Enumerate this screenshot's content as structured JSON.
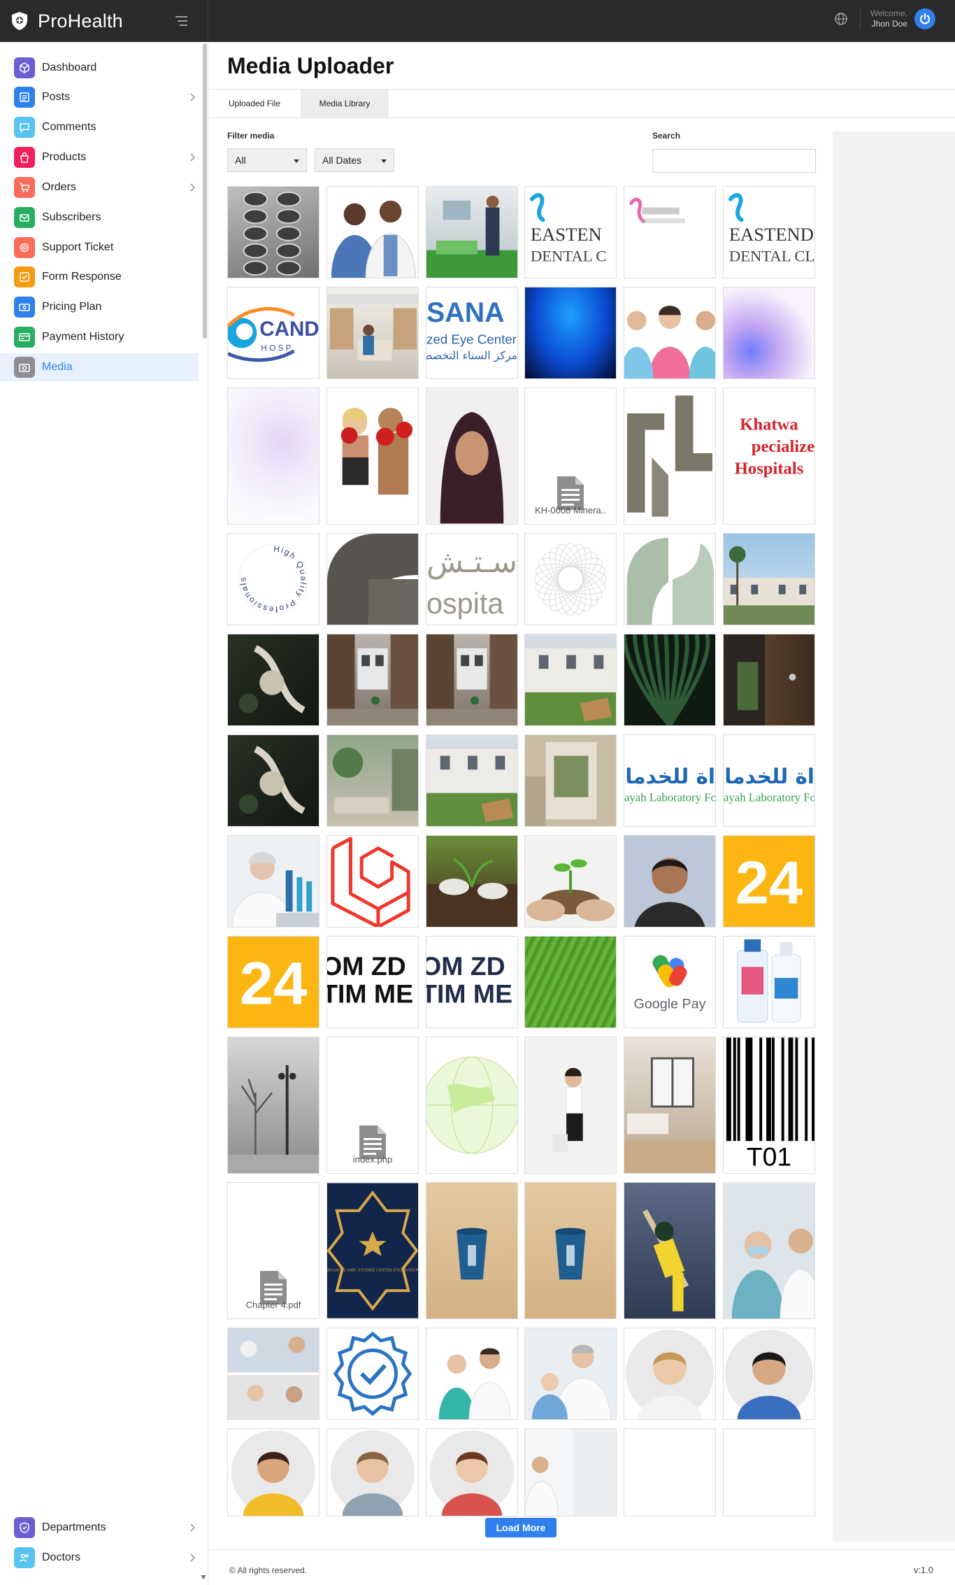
{
  "app": {
    "brand": "ProHealth"
  },
  "header": {
    "welcome_label": "Welcome,",
    "user_name": "Jhon Doe"
  },
  "sidebar": {
    "items": [
      {
        "label": "Dashboard",
        "icon": "cube-icon",
        "color": "#6c5dd3",
        "has_submenu": false
      },
      {
        "label": "Posts",
        "icon": "news-icon",
        "color": "#2f80ed",
        "has_submenu": true
      },
      {
        "label": "Comments",
        "icon": "comment-icon",
        "color": "#56c3f0",
        "has_submenu": false
      },
      {
        "label": "Products",
        "icon": "bag-icon",
        "color": "#f0205a",
        "has_submenu": true
      },
      {
        "label": "Orders",
        "icon": "cart-icon",
        "color": "#fb6b5b",
        "has_submenu": true
      },
      {
        "label": "Subscribers",
        "icon": "mail-icon",
        "color": "#27ae60",
        "has_submenu": false
      },
      {
        "label": "Support Ticket",
        "icon": "support-icon",
        "color": "#fb6b5b",
        "has_submenu": false
      },
      {
        "label": "Form Response",
        "icon": "form-icon",
        "color": "#f39c12",
        "has_submenu": false
      },
      {
        "label": "Pricing Plan",
        "icon": "money-icon",
        "color": "#2f80ed",
        "has_submenu": false
      },
      {
        "label": "Payment History",
        "icon": "receipt-icon",
        "color": "#27ae60",
        "has_submenu": false
      },
      {
        "label": "Media",
        "icon": "camera-icon",
        "color": "#8e8e93",
        "has_submenu": false,
        "active": true
      },
      {
        "label": "Departments",
        "icon": "shield-icon",
        "color": "#6c5dd3",
        "has_submenu": true
      },
      {
        "label": "Doctors",
        "icon": "people-icon",
        "color": "#56c3f0",
        "has_submenu": true
      }
    ]
  },
  "page": {
    "title": "Media Uploader",
    "tabs": [
      {
        "label": "Uploaded File"
      },
      {
        "label": "Media Library"
      }
    ],
    "filter_label": "Filter media",
    "filter_type": "All",
    "filter_date": "All Dates",
    "search_label": "Search",
    "search_value": ""
  },
  "media": {
    "items": [
      {
        "kind": "pills",
        "name": ""
      },
      {
        "kind": "doctors",
        "name": ""
      },
      {
        "kind": "hospital-room",
        "name": ""
      },
      {
        "kind": "logo-eastend",
        "name": "",
        "text1": "EASTEN",
        "text2": "DENTAL C"
      },
      {
        "kind": "logo-eastend-small",
        "name": ""
      },
      {
        "kind": "logo-eastend",
        "name": "",
        "text1": "EASTEND",
        "text2": "DENTAL CLIN"
      },
      {
        "kind": "logo-cand",
        "name": "",
        "text1": "CAND",
        "text2": "H O S P"
      },
      {
        "kind": "pharmacy",
        "name": ""
      },
      {
        "kind": "logo-sana",
        "name": "",
        "text1": "SANA",
        "text2": "zed Eye Center",
        "text3": "مركز السناء التخصص"
      },
      {
        "kind": "blue-gradient",
        "name": ""
      },
      {
        "kind": "nurses",
        "name": ""
      },
      {
        "kind": "pastel",
        "name": ""
      },
      {
        "kind": "pastel-light",
        "name": ""
      },
      {
        "kind": "boxers",
        "name": ""
      },
      {
        "kind": "portrait-hijab",
        "name": ""
      },
      {
        "kind": "document",
        "name": "KH-0008 Minera.."
      },
      {
        "kind": "khatwa-mark",
        "name": ""
      },
      {
        "kind": "khatwa-text",
        "name": "",
        "text1": "Khatwa",
        "text2": "pecialize",
        "text3": "Hospitals"
      },
      {
        "kind": "ring-text",
        "name": "",
        "text1": "High Quality Professionals"
      },
      {
        "kind": "shapes-dark",
        "name": ""
      },
      {
        "kind": "arabic-hospital",
        "name": "",
        "text1": "سـتـش",
        "text2": "ospita"
      },
      {
        "kind": "line-pattern",
        "name": ""
      },
      {
        "kind": "shapes-green",
        "name": ""
      },
      {
        "kind": "building",
        "name": ""
      },
      {
        "kind": "aerial-dark",
        "name": ""
      },
      {
        "kind": "corridor",
        "name": ""
      },
      {
        "kind": "corridor",
        "name": ""
      },
      {
        "kind": "courtyard",
        "name": ""
      },
      {
        "kind": "palm-leaf",
        "name": ""
      },
      {
        "kind": "door",
        "name": ""
      },
      {
        "kind": "aerial-dark",
        "name": ""
      },
      {
        "kind": "lounge",
        "name": ""
      },
      {
        "kind": "courtyard",
        "name": ""
      },
      {
        "kind": "beige-mockup",
        "name": ""
      },
      {
        "kind": "arabic-lab",
        "name": "",
        "text1": "اة للخدمات",
        "text2": "ayah Laboratory Fo"
      },
      {
        "kind": "arabic-lab",
        "name": "",
        "text1": "اة للخدمات",
        "text2": "ayah Laboratory Fo"
      },
      {
        "kind": "scientist",
        "name": ""
      },
      {
        "kind": "laravel",
        "name": ""
      },
      {
        "kind": "planting",
        "name": ""
      },
      {
        "kind": "seedling",
        "name": ""
      },
      {
        "kind": "man-portrait",
        "name": ""
      },
      {
        "kind": "num24",
        "name": "",
        "text1": "24"
      },
      {
        "kind": "num24",
        "name": "",
        "text1": "24"
      },
      {
        "kind": "omzd",
        "name": "",
        "text1": "OM ZD",
        "text2": "TIM ME"
      },
      {
        "kind": "omzd-navy",
        "name": "",
        "text1": "OM ZD",
        "text2": "TIM ME"
      },
      {
        "kind": "green-field",
        "name": ""
      },
      {
        "kind": "google-pay",
        "name": "",
        "text1": "Google Pay"
      },
      {
        "kind": "spray",
        "name": ""
      },
      {
        "kind": "foggy",
        "name": ""
      },
      {
        "kind": "document",
        "name": "index.php"
      },
      {
        "kind": "globe",
        "name": ""
      },
      {
        "kind": "woman-office",
        "name": ""
      },
      {
        "kind": "bedroom",
        "name": ""
      },
      {
        "kind": "barcode",
        "name": "",
        "text1": "T01"
      },
      {
        "kind": "document",
        "name": "Chapter 4.pdf"
      },
      {
        "kind": "qiyam",
        "name": "",
        "text1": "QIYAM ISLAMIC STUDIES CENTER FOUNDATION"
      },
      {
        "kind": "cup",
        "name": ""
      },
      {
        "kind": "cup",
        "name": ""
      },
      {
        "kind": "cricket",
        "name": ""
      },
      {
        "kind": "nurses-mask",
        "name": ""
      },
      {
        "kind": "care-collage",
        "name": ""
      },
      {
        "kind": "badge-check",
        "name": ""
      },
      {
        "kind": "medical-team",
        "name": ""
      },
      {
        "kind": "doctor-child",
        "name": ""
      },
      {
        "kind": "woman-round",
        "name": ""
      },
      {
        "kind": "man-round",
        "name": ""
      },
      {
        "kind": "woman-round-2",
        "name": ""
      },
      {
        "kind": "man-round-2",
        "name": ""
      },
      {
        "kind": "girl-round",
        "name": ""
      },
      {
        "kind": "doctor-window",
        "name": ""
      },
      {
        "kind": "blank",
        "name": ""
      },
      {
        "kind": "blank",
        "name": ""
      }
    ]
  },
  "actions": {
    "load_more": "Load More"
  },
  "footer": {
    "copyright": "© All rights reserved.",
    "version": "v:1.0"
  }
}
